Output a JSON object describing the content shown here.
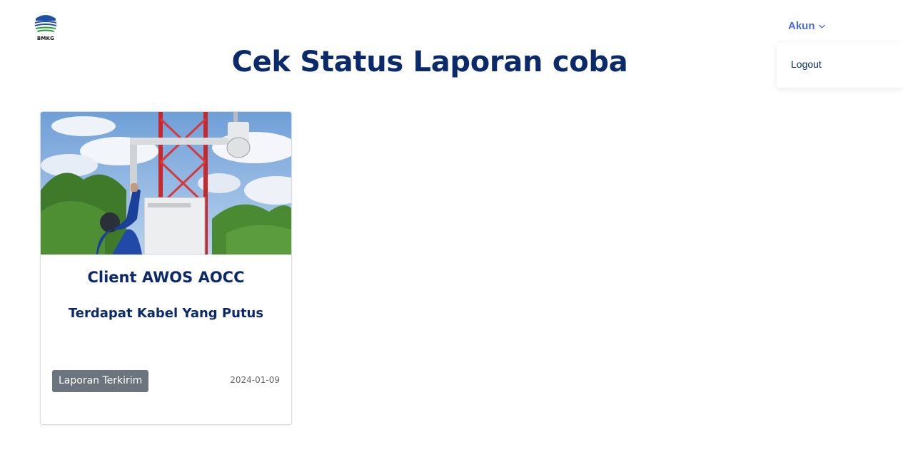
{
  "header": {
    "logo_text": "BMKG",
    "account_label": "Akun",
    "dropdown": {
      "items": [
        {
          "label": "Logout"
        }
      ]
    }
  },
  "page": {
    "title": "Cek Status Laporan coba"
  },
  "reports": [
    {
      "client": "Client AWOS AOCC",
      "issue": "Terdapat Kabel Yang Putus",
      "status": "Laporan Terkirim",
      "date": "2024-01-09"
    }
  ],
  "colors": {
    "primary_text": "#0b2a6b",
    "account_link": "#4a6bd9",
    "badge_bg": "#6c757d"
  },
  "icons": {
    "account_chevron": "chevron-down-icon"
  }
}
